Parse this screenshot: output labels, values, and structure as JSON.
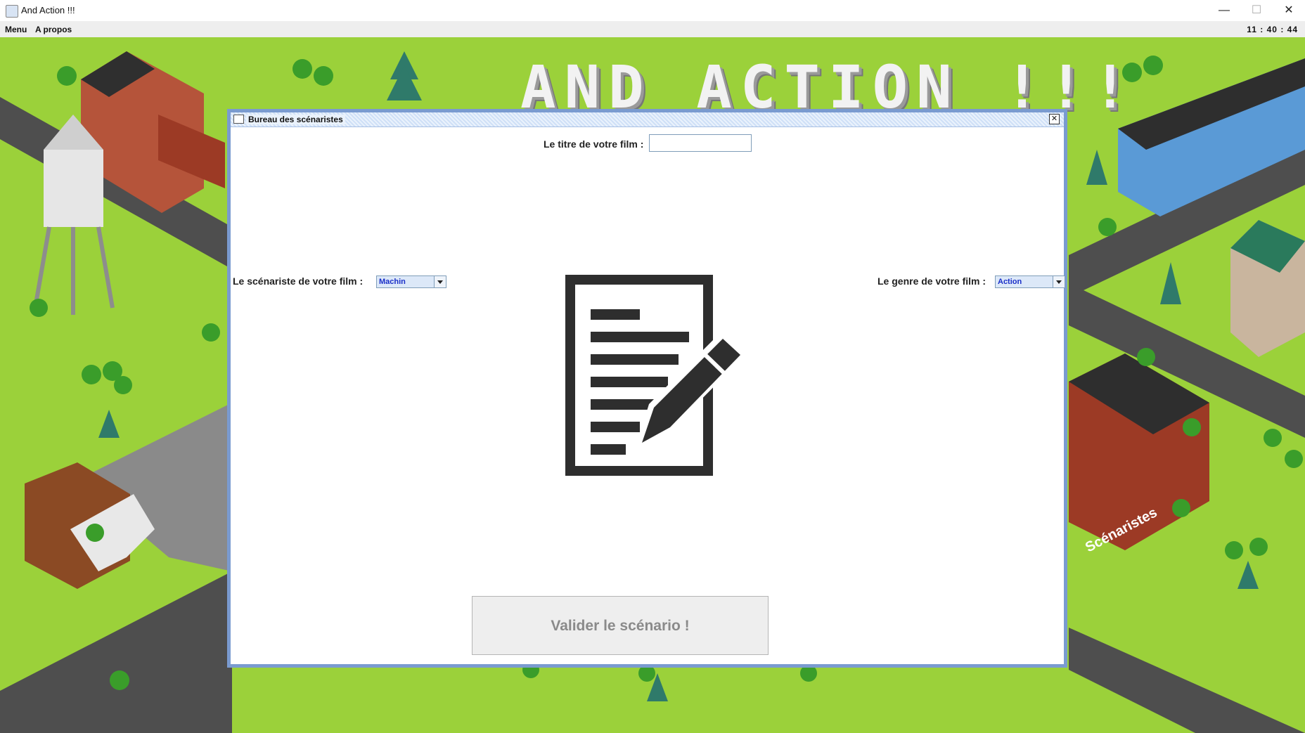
{
  "window": {
    "title": "And Action !!!",
    "minimize_glyph": "—",
    "maximize_glyph": "☐",
    "close_glyph": "✕"
  },
  "menubar": {
    "items": [
      "Menu",
      "A propos"
    ],
    "clock": "11 : 40 : 44"
  },
  "game": {
    "logo": "AND ACTION !!!",
    "zone_label": "Scénaristes"
  },
  "dialog": {
    "title": "Bureau des scénaristes",
    "close_glyph": "✕",
    "title_label": "Le titre de votre film :",
    "title_value": "",
    "writer_label": "Le scénariste de votre film :",
    "writer_selected": "Machin",
    "genre_label": "Le genre de votre film :",
    "genre_selected": "Action",
    "validate_label": "Valider le scénario !"
  },
  "colors": {
    "grass": "#9bd13a",
    "road": "#4e4e4e",
    "dialog_border": "#7a9bd0",
    "icon": "#2e2e2e"
  },
  "icons": {
    "app": "java-cup-icon",
    "dialog": "window-icon",
    "center": "document-edit-icon"
  }
}
